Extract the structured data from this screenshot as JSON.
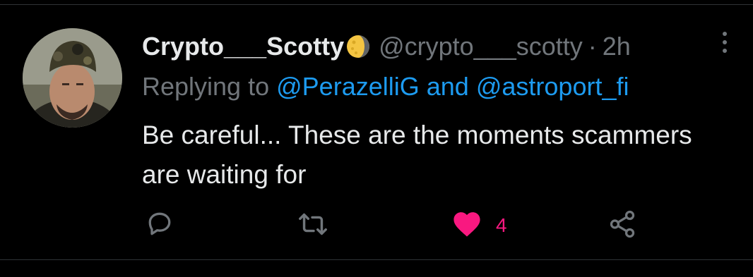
{
  "tweet": {
    "display_name": "Crypto___Scotty",
    "handle": "@crypto___scotty",
    "separator": "·",
    "time": "2h",
    "replying_prefix": "Replying to",
    "mention_1": "@PerazelliG",
    "mention_joiner": "and",
    "mention_2": "@astroport_fi",
    "text": "Be careful... These are the moments scammers are waiting for",
    "like_count": "4"
  },
  "icons": {
    "badge": "moon-emoji-icon",
    "more": "more-vertical-icon",
    "reply": "reply-icon",
    "retweet": "retweet-icon",
    "like": "heart-filled-icon",
    "share": "share-icon"
  },
  "colors": {
    "background": "#000000",
    "primary_text": "#e7e9ea",
    "secondary_text": "#71767b",
    "mention": "#1d9bf0",
    "like": "#f91880",
    "divider": "#2f3336"
  }
}
